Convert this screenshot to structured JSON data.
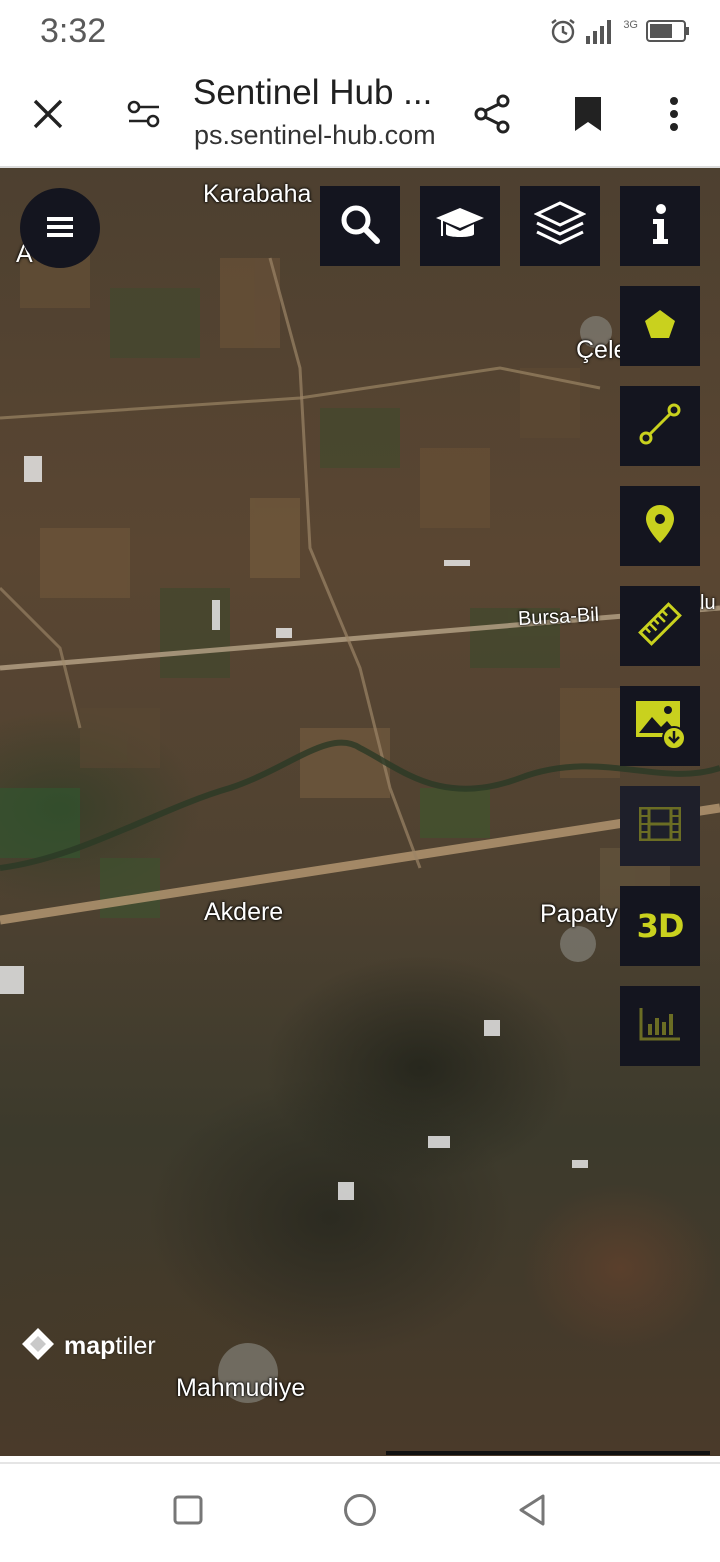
{
  "status_bar": {
    "time": "3:32",
    "network_label": "3G",
    "icons": [
      "alarm-icon",
      "signal-icon",
      "battery-icon"
    ]
  },
  "browser": {
    "page_title": "Sentinel Hub ...",
    "url": "ps.sentinel-hub.com",
    "icons": [
      "close-icon",
      "site-settings-icon",
      "share-icon",
      "bookmark-icon",
      "more-options-icon"
    ]
  },
  "map": {
    "labels": {
      "karabahadir": "Karabaha",
      "ai": "A",
      "cele": "Çele",
      "bursa_bilecik": "Bursa-Bil",
      "bursa_bilecik_suffix": "lu",
      "akdere": "Akdere",
      "papatya": "Papaty",
      "mahmudiye": "Mahmudiye"
    },
    "attribution": {
      "bold": "map",
      "regular": "tiler"
    }
  },
  "toolbar": {
    "top": [
      "search-icon",
      "education-mode-icon",
      "layers-icon",
      "info-icon"
    ],
    "side": [
      "polygon-aoi-icon",
      "line-measure-icon",
      "poi-marker-icon",
      "ruler-icon",
      "image-download-icon",
      "timelapse-film-icon",
      "3d-view-icon",
      "histogram-chart-icon"
    ],
    "label_3d": "3D",
    "accent_color": "#c9d11e",
    "dim_accent_color": "#6b6d24",
    "button_bg": "#14151f"
  },
  "nav_bar": {
    "icons": [
      "recents-square-icon",
      "home-circle-icon",
      "back-triangle-icon"
    ]
  }
}
